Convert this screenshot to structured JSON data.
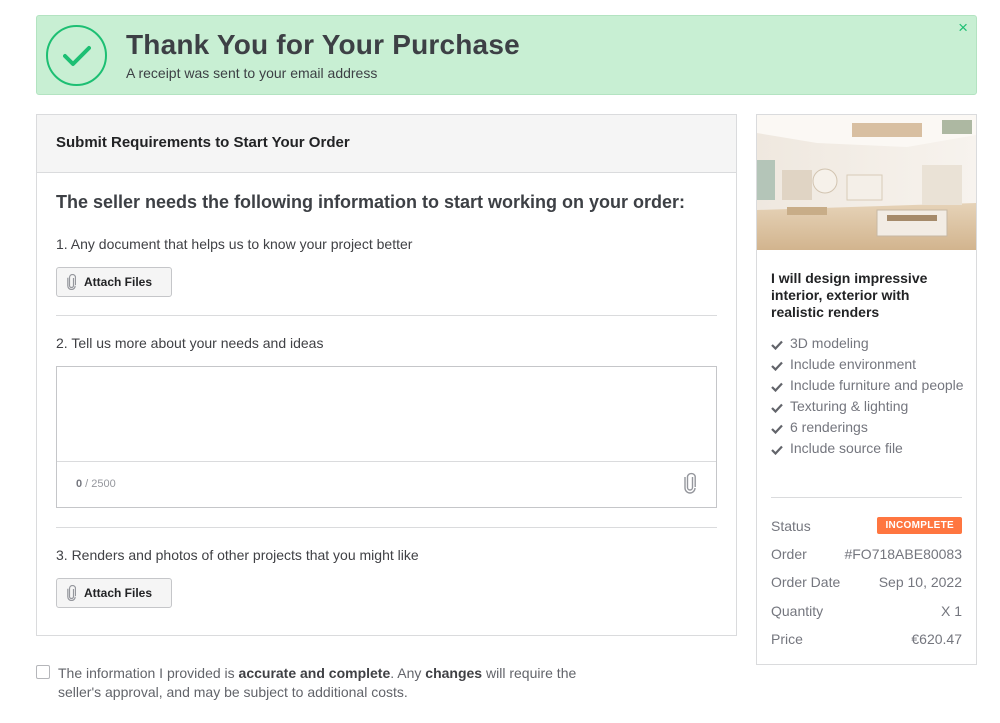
{
  "banner": {
    "title": "Thank You for Your Purchase",
    "subtitle": "A receipt was sent to your email address",
    "close": "×"
  },
  "requirements": {
    "header": "Submit Requirements to Start Your Order",
    "intro": "The seller needs the following information to start working on your order:",
    "q1": "1. Any document that helps us to know your project better",
    "q2": "2. Tell us more about your needs and ideas",
    "q3": "3. Renders and photos of other projects that you might like",
    "attach_label": "Attach Files",
    "textarea_value": "",
    "counter_current": "0",
    "counter_max": " / 2500"
  },
  "consent": {
    "part1": "The information I provided is ",
    "bold1": "accurate and complete",
    "part2": ". Any ",
    "bold2": "changes",
    "part3": " will require the seller's approval, and may be subject to additional costs."
  },
  "gig": {
    "title": "I will design impressive interior, exterior with realistic renders",
    "features": [
      "3D modeling",
      "Include environment",
      "Include furniture and people",
      "Texturing & lighting",
      "6 renderings",
      "Include source file"
    ]
  },
  "order": {
    "status_label": "Status",
    "status_value": "INCOMPLETE",
    "order_label": "Order",
    "order_value": "#FO718ABE80083",
    "date_label": "Order Date",
    "date_value": "Sep 10, 2022",
    "qty_label": "Quantity",
    "qty_value": "X 1",
    "price_label": "Price",
    "price_value": "€620.47"
  },
  "colors": {
    "accent": "#1dbf73",
    "banner_bg": "#c8efd3",
    "badge": "#ff7640"
  }
}
